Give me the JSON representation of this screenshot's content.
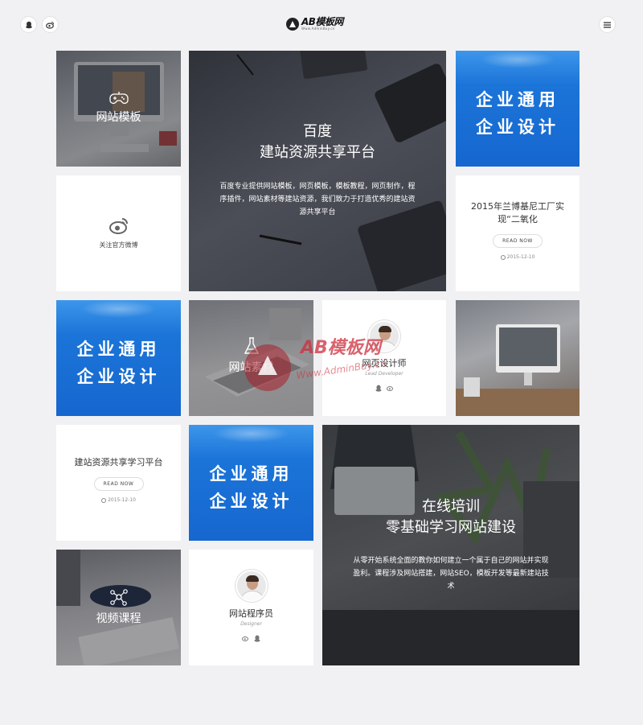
{
  "header": {
    "logo_main": "AB模板网",
    "logo_sub": "Www.AdminBuy.cn",
    "icons": [
      "qq-icon",
      "weibo-icon",
      "menu-icon"
    ]
  },
  "tiles": {
    "template": {
      "label": "网站模板",
      "icon": "gamepad-icon"
    },
    "hero": {
      "title_line1": "百度",
      "title_line2": "建站资源共享平台",
      "description": "百度专业提供网站模板，网页模板，模板教程，网页制作，程序插件，网站素材等建站资源，我们致力于打造优秀的建站资源共享平台"
    },
    "blue_banner": {
      "line1": "企业通用",
      "line2": "企业设计"
    },
    "weibo_follow": {
      "label": "关注官方微博",
      "icon": "weibo-icon"
    },
    "post1": {
      "title": "2015年兰博基尼工厂实现“二氧化",
      "read_more": "READ NOW",
      "date": "2015-12-10"
    },
    "materials": {
      "label": "网站素材",
      "icon": "flask-icon"
    },
    "designer": {
      "name": "网页设计师",
      "role": "Lead Developer"
    },
    "post2": {
      "title": "建站资源共享学习平台",
      "read_more": "READ NOW",
      "date": "2015-12-10"
    },
    "training": {
      "title_line1": "在线培训",
      "title_line2": "零基础学习网站建设",
      "description": "从零开始系统全面的教你如何建立一个属于自己的网站并实现盈利。课程涉及网站搭建，网站SEO，模板开发等最新建站技术"
    },
    "video": {
      "label": "视频课程",
      "icon": "share-icon"
    },
    "programmer": {
      "name": "网站程序员",
      "role": "Designer"
    }
  },
  "watermark": {
    "main": "AB模板网",
    "sub": "Www.AdminBuy.cn"
  },
  "colors": {
    "blue": "#1b74d8",
    "page_bg": "#f1f1f3",
    "dark_photo": "#3a3d45"
  }
}
